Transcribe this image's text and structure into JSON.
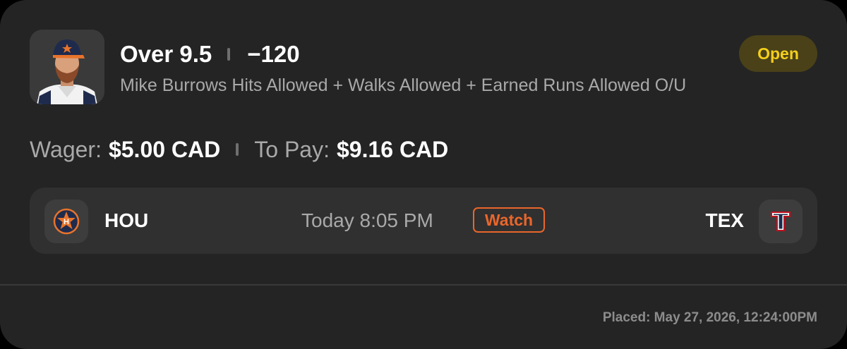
{
  "bet": {
    "selection": "Over 9.5",
    "odds": "−120",
    "market": "Mike Burrows Hits Allowed + Walks Allowed + Earned Runs Allowed O/U",
    "status": "Open",
    "player_image": "player-headshot"
  },
  "wager": {
    "wager_label": "Wager:",
    "wager_value": "$5.00 CAD",
    "pay_label": "To Pay:",
    "pay_value": "$9.16 CAD"
  },
  "game": {
    "home_team": "HOU",
    "away_team": "TEX",
    "home_logo_icon": "astros-logo-icon",
    "away_logo_icon": "rangers-logo-icon",
    "time": "Today 8:05 PM",
    "watch_label": "Watch"
  },
  "footer": {
    "placed": "Placed: May 27, 2026, 12:24:00PM"
  },
  "colors": {
    "card_bg": "#242424",
    "status_text": "#f4cf1b",
    "status_bg": "#4a4119",
    "watch_accent": "#e9662b",
    "muted_text": "#a9a9a9"
  }
}
